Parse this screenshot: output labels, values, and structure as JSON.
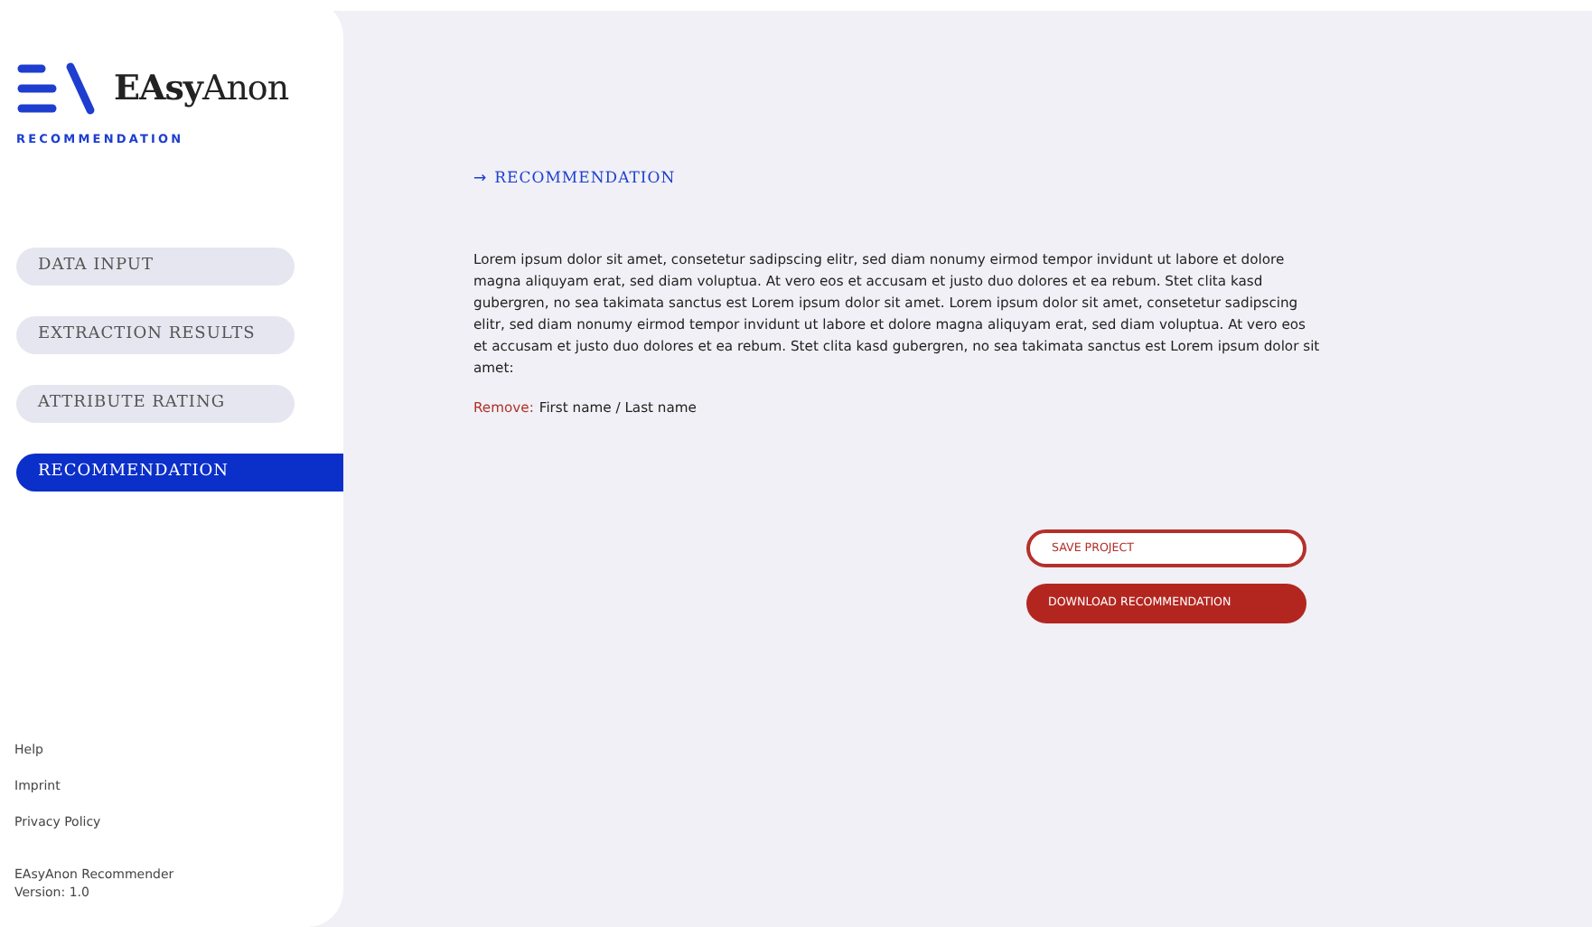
{
  "logo": {
    "text": "**EAsy**Anon",
    "subtitle": "RECOMMENDATION"
  },
  "nav": [
    {
      "label": "DATA INPUT",
      "selected": false
    },
    {
      "label": "EXTRACTION RESULTS",
      "selected": false
    },
    {
      "label": "ATTRIBUTE RATING",
      "selected": false
    },
    {
      "label": "RECOMMENDATION",
      "selected": true
    }
  ],
  "footer_links": [
    "Help",
    "Imprint",
    "Privacy Policy"
  ],
  "app_info": [
    "EAsyAnon Recommender",
    "Version: 1.0"
  ],
  "main": {
    "heading_arrow": "→",
    "heading": "RECOMMENDATION",
    "text": "Lorem ipsum dolor sit amet, consetetur sadipscing elitr, sed diam nonumy eirmod tempor invidunt ut labore et dolore magna aliquyam erat, sed diam voluptua. At vero eos et accusam et justo duo dolores et ea rebum. Stet clita kasd gubergren, no sea takimata sanctus est Lorem ipsum dolor sit amet. Lorem ipsum dolor sit amet, consetetur sadipscing elitr, sed diam nonumy eirmod tempor invidunt ut labore et dolore magna aliquyam erat, sed diam voluptua. At vero eos et accusam et justo duo dolores et ea rebum. Stet clita kasd gubergren, no sea takimata sanctus est Lorem ipsum dolor sit amet:",
    "remove_label": "Remove:",
    "remove_value": "First name / Last name"
  },
  "buttons": [
    {
      "label": "SAVE PROJECT",
      "kind": "outline"
    },
    {
      "label": "DOWNLOAD RECOMMENDATION",
      "kind": "filled"
    }
  ]
}
